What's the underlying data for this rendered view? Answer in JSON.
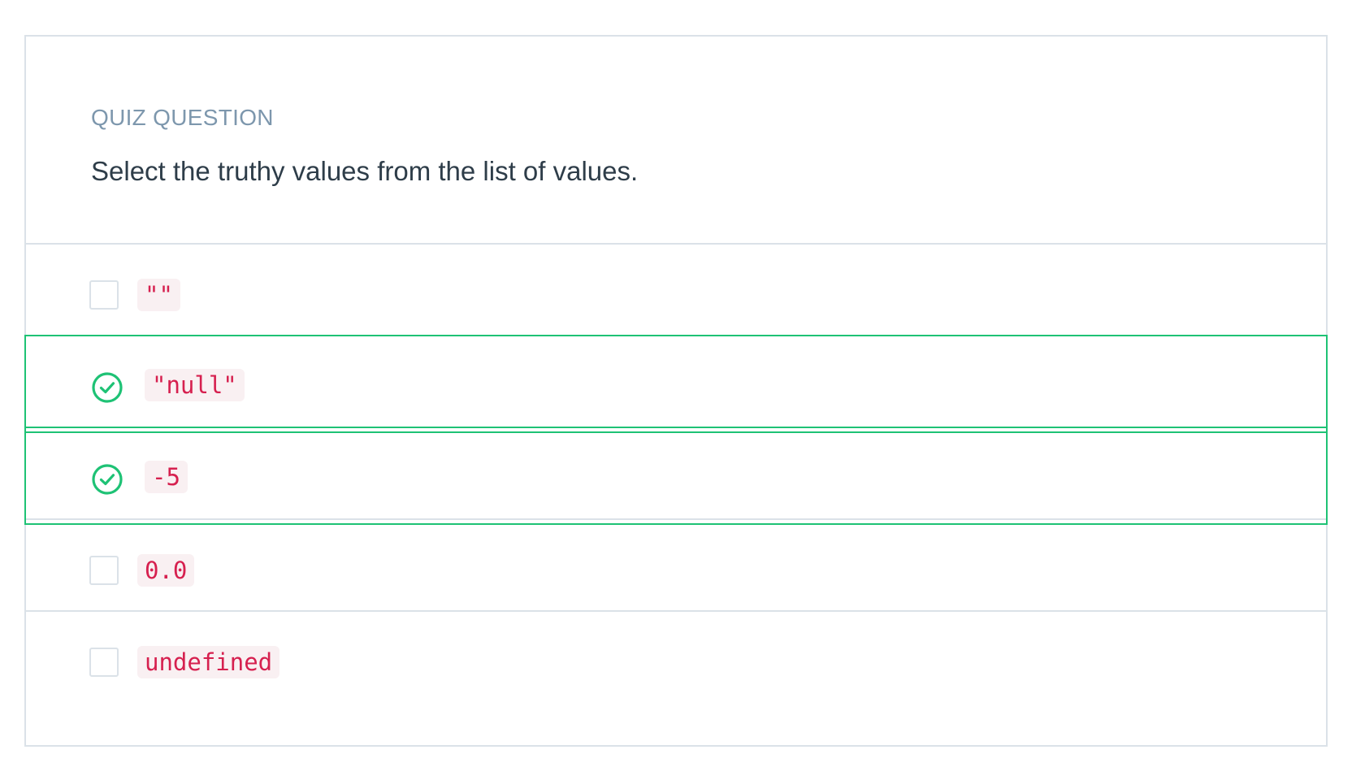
{
  "quiz": {
    "eyebrow": "QUIZ QUESTION",
    "prompt": "Select the truthy values from the list of values."
  },
  "options": [
    {
      "label": "\"\"",
      "selected": false
    },
    {
      "label": "\"null\"",
      "selected": true
    },
    {
      "label": "-5",
      "selected": true
    },
    {
      "label": "0.0",
      "selected": false
    },
    {
      "label": "undefined",
      "selected": false
    }
  ],
  "colors": {
    "selected_border": "#1ec275",
    "code_text": "#d6204f",
    "code_background": "#f9f0f2",
    "eyebrow_text": "#7d97ad",
    "prompt_text": "#2e3d49",
    "card_border": "#dbe2e8"
  },
  "icons": {
    "selected_indicator": "check-circle-icon",
    "unselected_indicator": "empty-checkbox"
  }
}
